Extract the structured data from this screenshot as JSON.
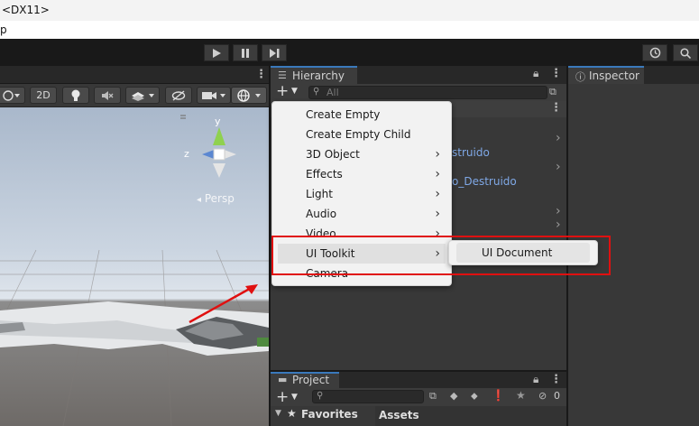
{
  "titlebar": {
    "text": "<DX11>"
  },
  "menubar": {
    "text": "p"
  },
  "scene": {
    "toolbar": {
      "mode_2d": "2D"
    },
    "gizmo": {
      "y": "y",
      "z": "z",
      "persp": "Persp"
    }
  },
  "hierarchy": {
    "tab_label": "Hierarchy",
    "search_placeholder": "All",
    "partial_items": [
      "struido",
      "o_Destruido"
    ]
  },
  "context_menu": {
    "items": [
      {
        "label": "Create Empty",
        "has_submenu": false
      },
      {
        "label": "Create Empty Child",
        "has_submenu": false
      },
      {
        "label": "3D Object",
        "has_submenu": true
      },
      {
        "label": "Effects",
        "has_submenu": true
      },
      {
        "label": "Light",
        "has_submenu": true
      },
      {
        "label": "Audio",
        "has_submenu": true
      },
      {
        "label": "Video",
        "has_submenu": true
      },
      {
        "label": "UI Toolkit",
        "has_submenu": true
      },
      {
        "label": "Camera",
        "has_submenu": false
      }
    ],
    "submenu": {
      "items": [
        "UI Document"
      ]
    }
  },
  "inspector": {
    "tab_label": "Inspector"
  },
  "project": {
    "tab_label": "Project",
    "hidden_count": "0",
    "favorites_label": "Favorites",
    "assets_label": "Assets"
  },
  "colors": {
    "accent_red": "#e01010",
    "tab_accent": "#3a79bb",
    "link_blue": "#7fa8e6"
  }
}
